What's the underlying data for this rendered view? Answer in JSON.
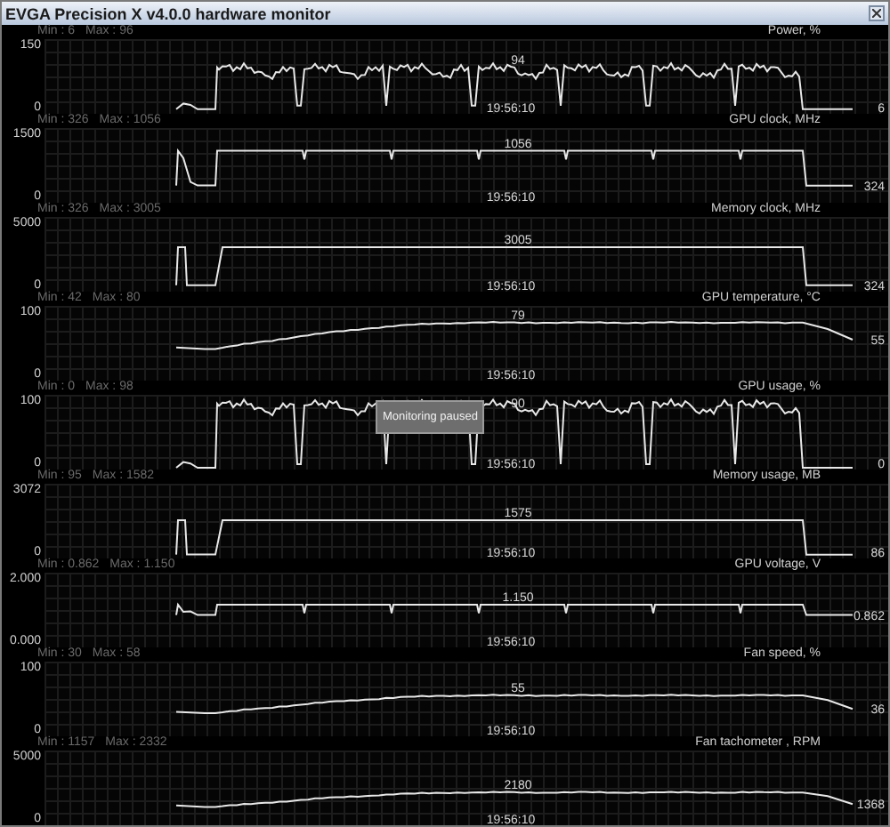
{
  "window": {
    "title": "EVGA Precision X v4.0.0 hardware monitor"
  },
  "panels": [
    {
      "title": "Power, %",
      "min": "Min : 6",
      "max": "Max : 96",
      "y_max": "150",
      "y_min": "0",
      "peak": "94",
      "current": "6",
      "time": "19:56:10",
      "kind": "noisy"
    },
    {
      "title": "GPU clock, MHz",
      "min": "Min : 326",
      "max": "Max : 1056",
      "y_max": "1500",
      "y_min": "0",
      "peak": "1056",
      "current": "324",
      "time": "19:56:10",
      "kind": "spiky"
    },
    {
      "title": "Memory clock, MHz",
      "min": "Min : 326",
      "max": "Max : 3005",
      "y_max": "5000",
      "y_min": "0",
      "peak": "3005",
      "current": "324",
      "time": "19:56:10",
      "kind": "step"
    },
    {
      "title": "GPU temperature, °C",
      "min": "Min : 42",
      "max": "Max : 80",
      "y_max": "100",
      "y_min": "0",
      "peak": "79",
      "current": "55",
      "time": "19:56:10",
      "kind": "ramp"
    },
    {
      "title": "GPU usage, %",
      "min": "Min : 0",
      "max": "Max : 98",
      "y_max": "100",
      "y_min": "0",
      "peak": "90",
      "current": "0",
      "time": "19:56:10",
      "kind": "noisy",
      "tooltip": "Monitoring paused"
    },
    {
      "title": "Memory usage, MB",
      "min": "Min : 95",
      "max": "Max : 1582",
      "y_max": "3072",
      "y_min": "0",
      "peak": "1575",
      "current": "86",
      "time": "19:56:10",
      "kind": "step"
    },
    {
      "title": "GPU voltage, V",
      "min": "Min : 0.862",
      "max": "Max : 1.150",
      "y_max": "2.000",
      "y_min": "0.000",
      "peak": "1.150",
      "current": "0.862",
      "time": "19:56:10",
      "kind": "spiky"
    },
    {
      "title": "Fan speed, %",
      "min": "Min : 30",
      "max": "Max : 58",
      "y_max": "100",
      "y_min": "0",
      "peak": "55",
      "current": "36",
      "time": "19:56:10",
      "kind": "ramp"
    },
    {
      "title": "Fan tachometer , RPM",
      "min": "Min : 1157",
      "max": "Max : 2332",
      "y_max": "5000",
      "y_min": "0",
      "peak": "2180",
      "current": "1368",
      "time": "19:56:10",
      "kind": "ramp"
    }
  ]
}
